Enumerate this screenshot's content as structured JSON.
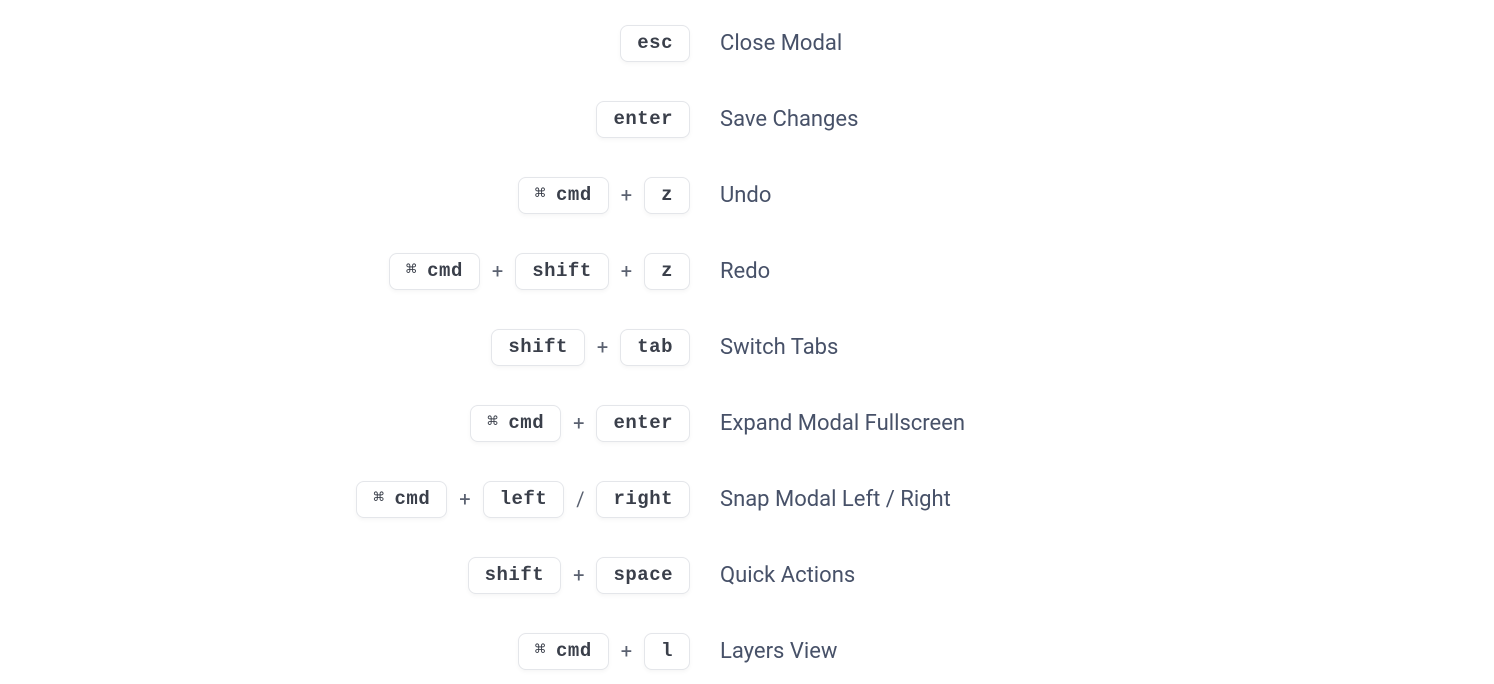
{
  "cmd_glyph": "⌘",
  "shortcuts": [
    {
      "keys": [
        {
          "t": "key",
          "v": "esc"
        }
      ],
      "desc": "Close Modal"
    },
    {
      "keys": [
        {
          "t": "key",
          "v": "enter"
        }
      ],
      "desc": "Save Changes"
    },
    {
      "keys": [
        {
          "t": "cmd",
          "v": "cmd"
        },
        {
          "t": "sep",
          "v": "+"
        },
        {
          "t": "key",
          "v": "z"
        }
      ],
      "desc": "Undo"
    },
    {
      "keys": [
        {
          "t": "cmd",
          "v": "cmd"
        },
        {
          "t": "sep",
          "v": "+"
        },
        {
          "t": "key",
          "v": "shift"
        },
        {
          "t": "sep",
          "v": "+"
        },
        {
          "t": "key",
          "v": "z"
        }
      ],
      "desc": "Redo"
    },
    {
      "keys": [
        {
          "t": "key",
          "v": "shift"
        },
        {
          "t": "sep",
          "v": "+"
        },
        {
          "t": "key",
          "v": "tab"
        }
      ],
      "desc": "Switch Tabs"
    },
    {
      "keys": [
        {
          "t": "cmd",
          "v": "cmd"
        },
        {
          "t": "sep",
          "v": "+"
        },
        {
          "t": "key",
          "v": "enter"
        }
      ],
      "desc": "Expand Modal Fullscreen"
    },
    {
      "keys": [
        {
          "t": "cmd",
          "v": "cmd"
        },
        {
          "t": "sep",
          "v": "+"
        },
        {
          "t": "key",
          "v": "left"
        },
        {
          "t": "sep",
          "v": "/"
        },
        {
          "t": "key",
          "v": "right"
        }
      ],
      "desc": "Snap Modal Left / Right"
    },
    {
      "keys": [
        {
          "t": "key",
          "v": "shift"
        },
        {
          "t": "sep",
          "v": "+"
        },
        {
          "t": "key",
          "v": "space"
        }
      ],
      "desc": "Quick Actions"
    },
    {
      "keys": [
        {
          "t": "cmd",
          "v": "cmd"
        },
        {
          "t": "sep",
          "v": "+"
        },
        {
          "t": "key",
          "v": "l"
        }
      ],
      "desc": "Layers View"
    }
  ]
}
